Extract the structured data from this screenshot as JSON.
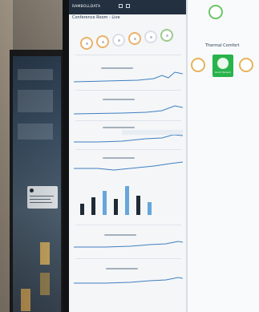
{
  "photo": {
    "screen_header": {
      "brand": "RAMBOLLDATA"
    },
    "room_title": "Conference Room - Live",
    "thermal_panel": {
      "title": "Thermal Comfort",
      "status_text": "Good (Green)"
    },
    "colors": {
      "screen_bg": "#f4f6f8",
      "topbar": "#22303f",
      "gauge_accent": "#e9b26a",
      "comfort_green": "#29b34b",
      "bar_dark": "#1f2a35",
      "bar_blue": "#66a6db"
    }
  }
}
